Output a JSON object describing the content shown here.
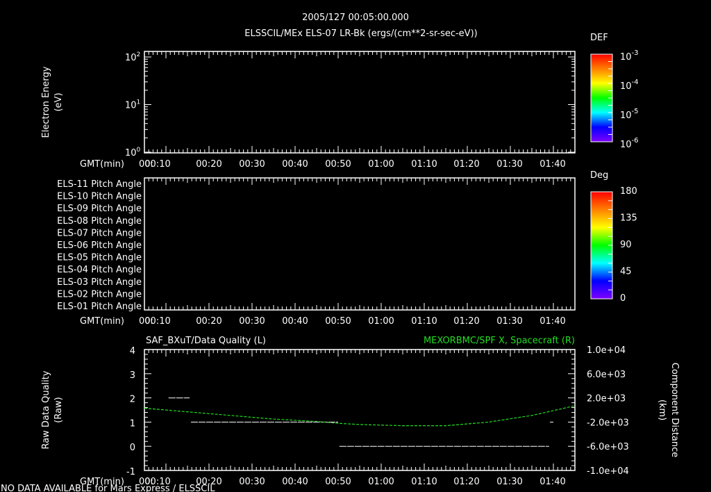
{
  "header": {
    "title": "2005/127 00:05:00.000",
    "subtitle": "ELSSCIL/MEx ELS-07 LR-Bk  (ergs/(cm**2-sr-sec-eV))"
  },
  "footer": {
    "status": "NO DATA AVAILABLE for Mars  Express / ELSSCIL"
  },
  "colors": {
    "background": "#000000",
    "axes": "#ffffff",
    "quality_line": "#ffffff",
    "position_line": "#22dd22",
    "colorbar": [
      "#7f00ff",
      "#0000ff",
      "#00ffff",
      "#00ff00",
      "#ffff00",
      "#ff8000",
      "#ff0000"
    ]
  },
  "time_axis": {
    "label": "GMT(min)",
    "ticks": [
      "00:",
      "00:10",
      "00:20",
      "00:30",
      "00:40",
      "00:50",
      "01:00",
      "01:10",
      "01:20",
      "01:30",
      "01:40"
    ],
    "range_min": [
      5,
      105
    ]
  },
  "chart_data": [
    {
      "type": "heatmap",
      "ylabel": [
        "Electron Energy",
        "(eV)"
      ],
      "yscale": "log",
      "ylim": [
        1,
        130
      ],
      "ytick_labels": [
        {
          "base": "10",
          "exp": "0",
          "v": 1
        },
        {
          "base": "10",
          "exp": "1",
          "v": 10
        },
        {
          "base": "10",
          "exp": "2",
          "v": 100
        }
      ],
      "colorbar": {
        "title": "DEF",
        "scale": "log",
        "ticks": [
          {
            "base": "10",
            "exp": "-6"
          },
          {
            "base": "10",
            "exp": "-5"
          },
          {
            "base": "10",
            "exp": "-4"
          },
          {
            "base": "10",
            "exp": "-3"
          }
        ]
      },
      "values": []
    },
    {
      "type": "heatmap",
      "row_labels": [
        "ELS-11 Pitch Angle",
        "ELS-10 Pitch Angle",
        "ELS-09 Pitch Angle",
        "ELS-08 Pitch Angle",
        "ELS-07 Pitch Angle",
        "ELS-06 Pitch Angle",
        "ELS-05 Pitch Angle",
        "ELS-04 Pitch Angle",
        "ELS-03 Pitch Angle",
        "ELS-02 Pitch Angle",
        "ELS-01 Pitch Angle"
      ],
      "colorbar": {
        "title": "Deg",
        "ticks": [
          "180",
          "135",
          "90",
          "45",
          "0"
        ]
      },
      "values": []
    },
    {
      "type": "line",
      "title_left": "SAF_BXuT/Data Quality (L)",
      "title_right": "MEXORBMC/SPF X, Spacecraft (R)",
      "ylabel_left": [
        "Raw Data Quality",
        "(Raw)"
      ],
      "ylabel_right": [
        "Component Distance",
        "(km)"
      ],
      "ylim_left": [
        -1,
        4
      ],
      "yticks_left": [
        "-1",
        "0",
        "1",
        "2",
        "3",
        "4"
      ],
      "ylim_right": [
        -10000,
        10000
      ],
      "yticks_right": [
        "-1.0e+04",
        "-6.0e+03",
        "-2.0e+03",
        "2.0e+03",
        "6.0e+03",
        "1.0e+04"
      ],
      "series": [
        {
          "axis": "left",
          "segments": [
            [
              10.6,
              15.5,
              2
            ],
            [
              15.8,
              50,
              1
            ],
            [
              50.3,
              99,
              0
            ],
            [
              99.2,
              100,
              1
            ]
          ]
        },
        {
          "axis": "right",
          "x": [
            5,
            15,
            25,
            35,
            45,
            50,
            55,
            65,
            75,
            85,
            95,
            105
          ],
          "y": [
            300,
            -300,
            -900,
            -1500,
            -1900,
            -2200,
            -2400,
            -2600,
            -2600,
            -2000,
            -900,
            700
          ]
        }
      ]
    }
  ]
}
